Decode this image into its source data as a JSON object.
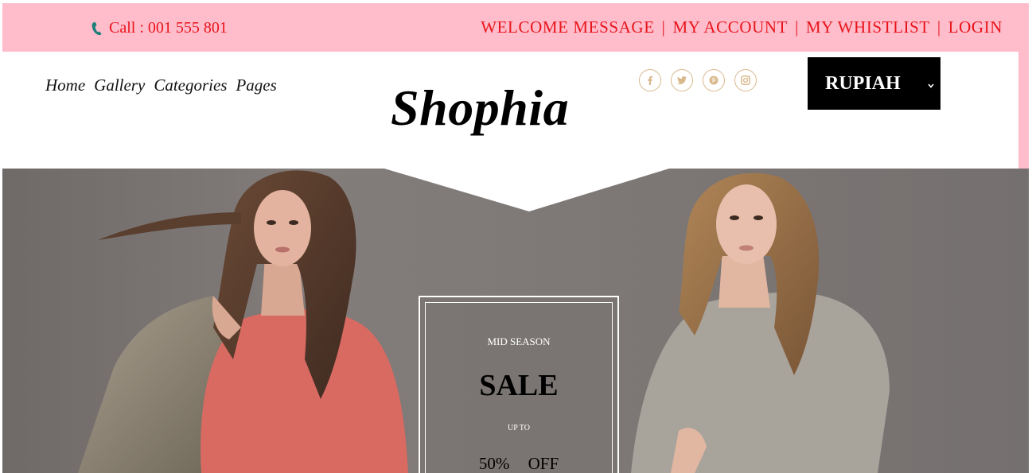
{
  "topbar": {
    "phone_icon": "phone-icon",
    "phone_text": "Call : 001 555 801",
    "links": {
      "welcome": "WELCOME MESSAGE",
      "account": "MY ACCOUNT",
      "wishlist": "MY WHISTLIST",
      "login": "LOGIN"
    },
    "separator": "|"
  },
  "header": {
    "nav": {
      "home": "Home",
      "gallery": "Gallery",
      "categories": "Categories",
      "pages": "Pages"
    },
    "logo": "Shophia",
    "social_icons": [
      "facebook-icon",
      "twitter-icon",
      "pinterest-icon",
      "instagram-icon"
    ],
    "currency": {
      "selected": "RUPIAH",
      "chevron": "⌄"
    }
  },
  "hero": {
    "sale": {
      "eyebrow": "MID SEASON",
      "headline": "SALE",
      "upto": "UP TO",
      "percent": "50%",
      "off": "OFF"
    }
  },
  "colors": {
    "topbar_bg": "#ffbccb",
    "link_red": "#e8141b",
    "social_gold": "#d9b98c",
    "hero_gray": "#7d7775"
  }
}
